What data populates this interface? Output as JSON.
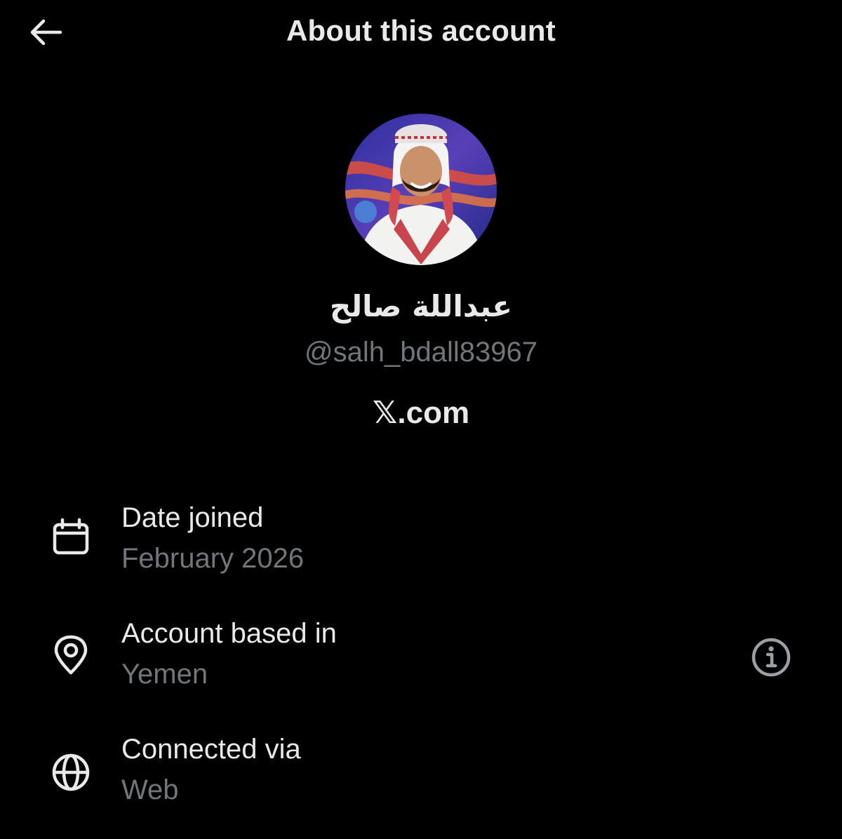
{
  "header": {
    "title": "About this account",
    "back_icon": "arrow-left-icon"
  },
  "profile": {
    "avatar_icon": "profile-photo",
    "display_name": "عبداللة صالح",
    "handle": "@salh_bdall83967",
    "source": "𝕏.com"
  },
  "details": [
    {
      "icon": "calendar-icon",
      "label": "Date joined",
      "value": "February 2026"
    },
    {
      "icon": "location-pin-icon",
      "label": "Account based in",
      "value": "Yemen",
      "action_icon": "info-icon"
    },
    {
      "icon": "globe-icon",
      "label": "Connected via",
      "value": "Web"
    }
  ],
  "colors": {
    "background": "#000000",
    "primary_text": "#e7e9ea",
    "secondary_text": "#71767b"
  }
}
